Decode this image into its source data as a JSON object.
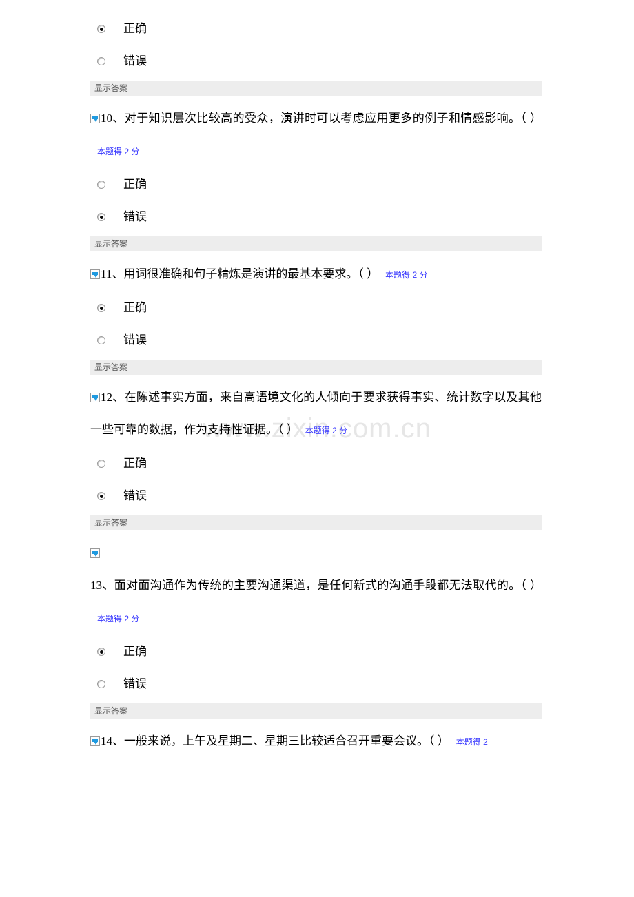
{
  "watermark": {
    "text": "www.zixin.com.cn"
  },
  "labels": {
    "show_answer": "显示答案",
    "option_true": "正确",
    "option_false": "错误",
    "flag_icon": "blue-flag-icon"
  },
  "top_partial_question": {
    "options": [
      {
        "label": "正确",
        "checked": true
      },
      {
        "label": "错误",
        "checked": false
      }
    ],
    "show_answer": "显示答案"
  },
  "questions": [
    {
      "number": "10",
      "text": "10、对于知识层次比较高的受众，演讲时可以考虑应用更多的例子和情感影响。（ ）",
      "score": "本题得 2 分",
      "options": [
        {
          "label": "正确",
          "checked": false
        },
        {
          "label": "错误",
          "checked": true
        }
      ],
      "show_answer": "显示答案"
    },
    {
      "number": "11",
      "text": "11、用词很准确和句子精炼是演讲的最基本要求。（ ）",
      "score": "本题得 2 分",
      "options": [
        {
          "label": "正确",
          "checked": true
        },
        {
          "label": "错误",
          "checked": false
        }
      ],
      "show_answer": "显示答案"
    },
    {
      "number": "12",
      "text": "12、在陈述事实方面，来自高语境文化的人倾向于要求获得事实、统计数字以及其他一些可靠的数据，作为支持性证据。（ ）",
      "score": "本题得 2 分",
      "options": [
        {
          "label": "正确",
          "checked": false
        },
        {
          "label": "错误",
          "checked": true
        }
      ],
      "show_answer": "显示答案"
    },
    {
      "number": "13",
      "text": "13、面对面沟通作为传统的主要沟通渠道，是任何新式的沟通手段都无法取代的。（ ）",
      "score": "本题得 2 分",
      "options": [
        {
          "label": "正确",
          "checked": true
        },
        {
          "label": "错误",
          "checked": false
        }
      ],
      "show_answer": "显示答案"
    },
    {
      "number": "14",
      "text": "14、一般来说，上午及星期二、星期三比较适合召开重要会议。（ ）",
      "score": "本题得 2",
      "options": [],
      "show_answer": ""
    }
  ]
}
